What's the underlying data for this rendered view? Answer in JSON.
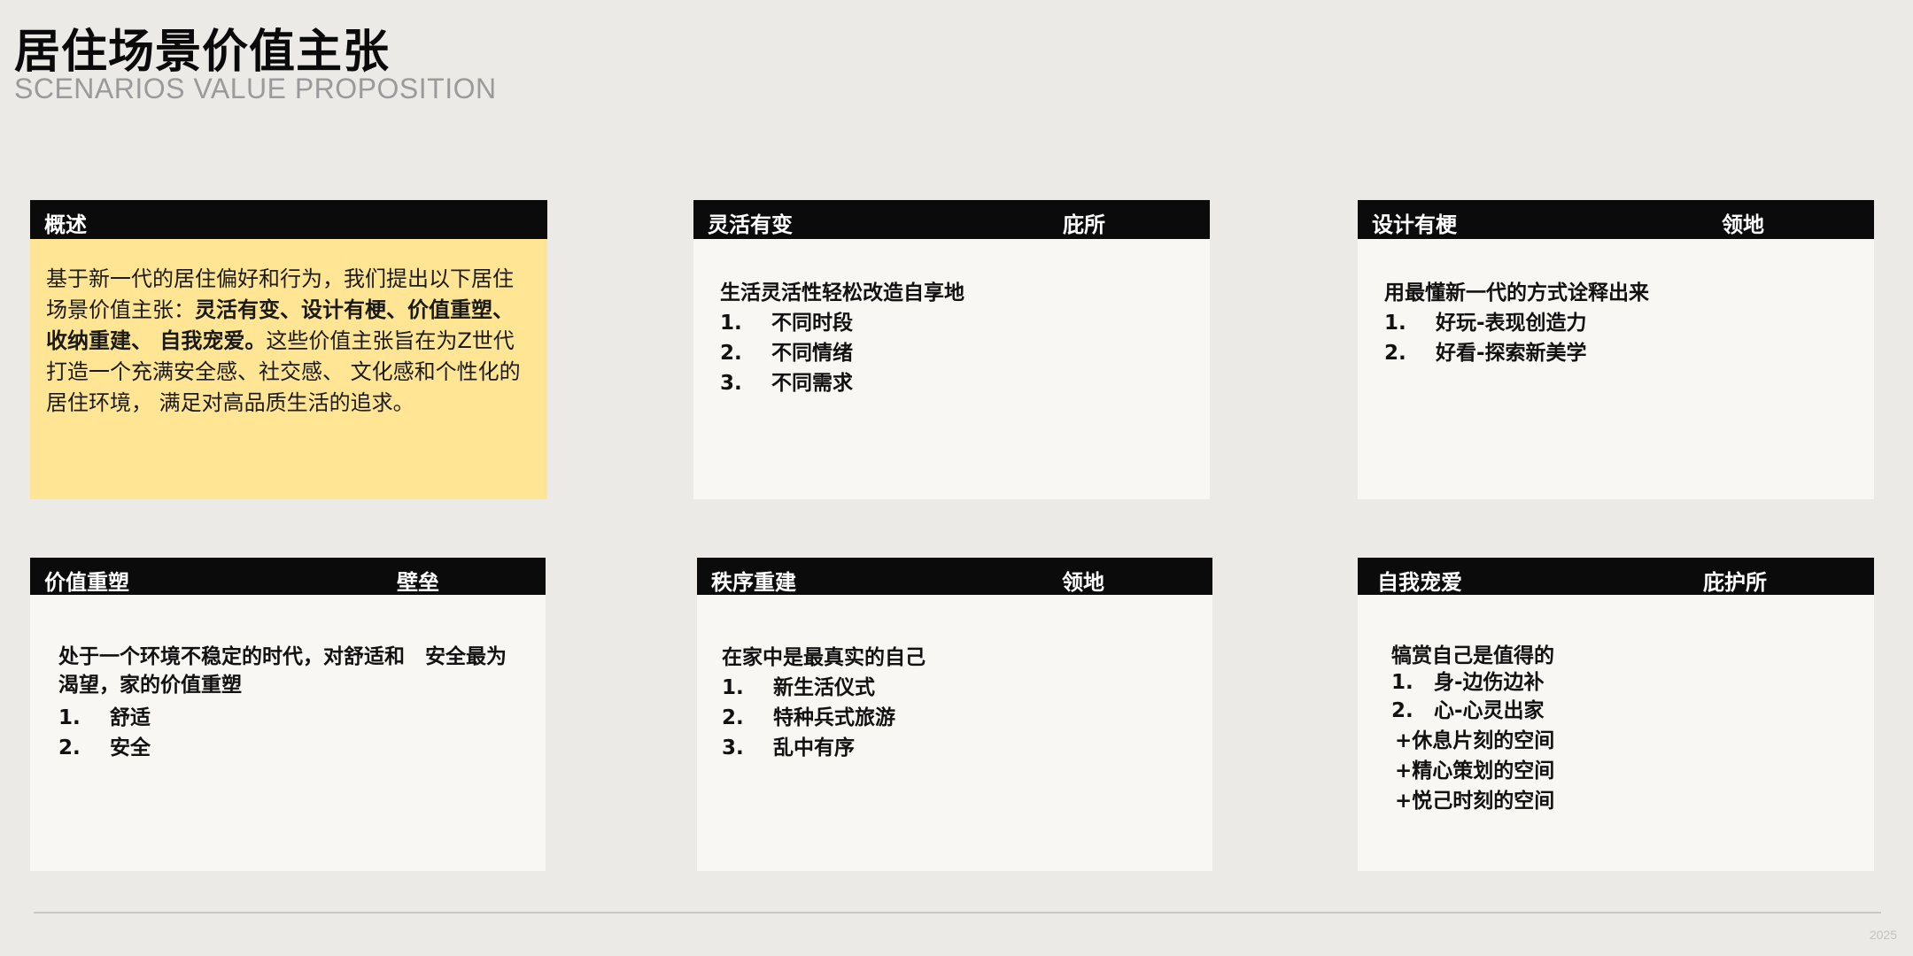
{
  "header": {
    "title": "居住场景价值主张",
    "subtitle": "SCENARIOS VALUE PROPOSITION"
  },
  "cards": {
    "overview": {
      "title": "概述",
      "text_a": "基于新一代的居住偏好和行为，我们提出以下居住场景价值主张：",
      "text_bold": "灵活有变、设计有梗、价值重塑、收纳重建、 自我宠爱。",
      "text_b": "这些价值主张旨在为Z世代打造一个充满安全感、社交感、 文化感和个性化的居住环境， 满足对高品质生活的追求。"
    },
    "flexible": {
      "title": "灵活有变",
      "tag": "庇所",
      "heading": "生活灵活性轻松改造自享地",
      "items": [
        {
          "num": "1.",
          "text": "不同时段"
        },
        {
          "num": "2.",
          "text": "不同情绪"
        },
        {
          "num": "3.",
          "text": "不同需求"
        }
      ]
    },
    "design": {
      "title": "设计有梗",
      "tag": "领地",
      "heading": "用最懂新一代的方式诠释出来",
      "items": [
        {
          "num": "1.",
          "text": "好玩-表现创造力"
        },
        {
          "num": "2.",
          "text": "好看-探索新美学"
        }
      ]
    },
    "value": {
      "title": "价值重塑",
      "tag": "壁垒",
      "heading": "处于一个环境不稳定的时代，对舒适和　安全最为渴望，家的价值重塑",
      "items": [
        {
          "num": "1.",
          "text": "舒适"
        },
        {
          "num": "2.",
          "text": "安全"
        }
      ]
    },
    "order": {
      "title": "秩序重建",
      "tag": "领地",
      "heading": "在家中是最真实的自己",
      "items": [
        {
          "num": "1.",
          "text": "新生活仪式"
        },
        {
          "num": "2.",
          "text": "特种兵式旅游"
        },
        {
          "num": "3.",
          "text": "乱中有序"
        }
      ]
    },
    "selfcare": {
      "title": "自我宠爱",
      "tag": "庇护所",
      "heading": "犒赏自己是值得的",
      "items": [
        {
          "num": "1.",
          "text": "身-边伤边补"
        },
        {
          "num": "2.",
          "text": "心-心灵出家"
        }
      ],
      "extras": [
        "+休息片刻的空间",
        "+精心策划的空间",
        "+悦己时刻的空间"
      ]
    }
  },
  "footer": {
    "year": "2025"
  }
}
